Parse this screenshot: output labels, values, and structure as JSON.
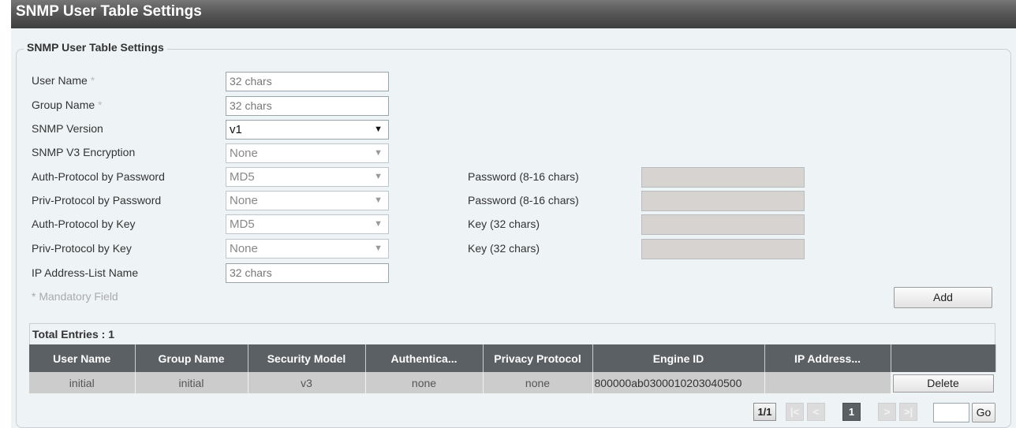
{
  "page": {
    "title": "SNMP User Table Settings"
  },
  "form": {
    "legend": "SNMP User Table Settings",
    "required_marker": "*",
    "fields": {
      "user_name": {
        "label": "User Name",
        "placeholder": "32 chars"
      },
      "group_name": {
        "label": "Group Name",
        "placeholder": "32 chars"
      },
      "snmp_version": {
        "label": "SNMP Version",
        "value": "v1"
      },
      "v3_encryption": {
        "label": "SNMP V3 Encryption",
        "value": "None"
      },
      "auth_by_password": {
        "label": "Auth-Protocol by Password",
        "value": "MD5",
        "side_label": "Password (8-16 chars)"
      },
      "priv_by_password": {
        "label": "Priv-Protocol by Password",
        "value": "None",
        "side_label": "Password (8-16 chars)"
      },
      "auth_by_key": {
        "label": "Auth-Protocol by Key",
        "value": "MD5",
        "side_label": "Key (32 chars)"
      },
      "priv_by_key": {
        "label": "Priv-Protocol by Key",
        "value": "None",
        "side_label": "Key (32 chars)"
      },
      "ip_list_name": {
        "label": "IP Address-List Name",
        "placeholder": "32 chars"
      }
    },
    "mandatory_note": "* Mandatory Field",
    "add_label": "Add"
  },
  "table": {
    "total_entries": "Total Entries : 1",
    "columns": [
      "User Name",
      "Group Name",
      "Security Model",
      "Authentica...",
      "Privacy Protocol",
      "Engine ID",
      "IP Address...",
      ""
    ],
    "rows": [
      {
        "user_name": "initial",
        "group_name": "initial",
        "security_model": "v3",
        "auth": "none",
        "privacy": "none",
        "engine_id": "800000ab0300010203040500",
        "ip_address": "",
        "action": "Delete"
      }
    ]
  },
  "pager": {
    "total": "1/1",
    "first": "|<",
    "prev": "<",
    "current": "1",
    "next": ">",
    "last": ">|",
    "go_label": "Go"
  }
}
